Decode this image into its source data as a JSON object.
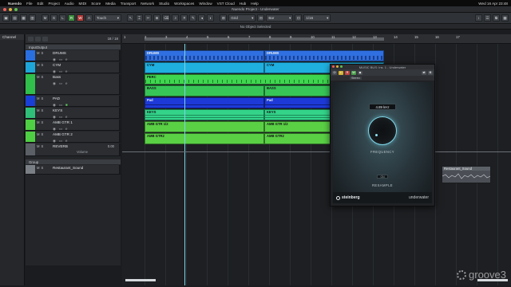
{
  "menubar": {
    "items": [
      "Nuendo",
      "File",
      "Edit",
      "Project",
      "Audio",
      "MIDI",
      "Score",
      "Media",
      "Transport",
      "Network",
      "Studio",
      "Workspaces",
      "Window",
      "VST Cloud",
      "Hub",
      "Help"
    ],
    "clock": "Wed 16 Apr 23:48"
  },
  "window": {
    "title": "Nuendo Project - Underwater"
  },
  "toolbar": {
    "buttons": [
      "M",
      "S",
      "L",
      "R",
      "W",
      "A"
    ],
    "automation_mode": "Touch",
    "snap_mode": "Grid",
    "grid_type": "Bar",
    "quantize": "1/16"
  },
  "status": {
    "text": "No Object Selected"
  },
  "left_zone": {
    "header": "Channel"
  },
  "tracklist": {
    "count": "18 / 18",
    "folders": [
      {
        "label": "InputOutput"
      },
      {
        "label": "Group"
      }
    ],
    "tracks": [
      {
        "name": "DRUMS",
        "color": "#2a6fe0"
      },
      {
        "name": "CYM",
        "color": "#1fa6d8"
      },
      {
        "name": "Bass",
        "color": "#2fbf4a"
      },
      {
        "name": "PERC",
        "color": "#2fbf4a"
      },
      {
        "name": "PAD",
        "color": "#1a3fd6"
      },
      {
        "name": "KEYS",
        "color": "#2fbf78"
      },
      {
        "name": "AMB GTR 1",
        "color": "#4fcf43"
      },
      {
        "name": "AMB GTR 2",
        "color": "#4fcf43"
      },
      {
        "name": "REVERB",
        "color": "#5b6066",
        "value": "0.00",
        "send": "Volume"
      },
      {
        "name": "Restaurant_Sound",
        "color": "#7a7f86"
      }
    ]
  },
  "ruler": {
    "numbers": [
      "1",
      "2",
      "3",
      "4",
      "5",
      "6",
      "7",
      "8",
      "9",
      "10",
      "11",
      "12",
      "13",
      "14",
      "15",
      "16",
      "17"
    ]
  },
  "arrange": {
    "events": [
      {
        "label": "DRUMS",
        "color": "#2f6fe0"
      },
      {
        "label": "DRUMS",
        "color": "#2f6fe0"
      },
      {
        "label": "CYM",
        "color": "#1fb0e0"
      },
      {
        "label": "CYM",
        "color": "#1fb0e0"
      },
      {
        "label": "PERC",
        "color": "#3fd64f"
      },
      {
        "label": "BASS",
        "color": "#37c557"
      },
      {
        "label": "BASS",
        "color": "#37c557"
      },
      {
        "label": "Pad",
        "color": "#1d3ad8"
      },
      {
        "label": "Pad",
        "color": "#1d3ad8"
      },
      {
        "label": "KEYS",
        "color": "#33d38a"
      },
      {
        "label": "KEYS",
        "color": "#33d38a"
      },
      {
        "label": "AMB GTR 1/2",
        "color": "#5ad045"
      },
      {
        "label": "AMB GTR 1/2",
        "color": "#5ad045"
      },
      {
        "label": "AMB GTR2",
        "color": "#5ad045"
      },
      {
        "label": "AMB GTR2",
        "color": "#5ad045"
      }
    ],
    "audio_clip": "Restaurant_Sound"
  },
  "plugin": {
    "title": "MUSIC BUS: Ins. 1 - Underwater",
    "preset_bar": [
      "Stereo"
    ],
    "frequency_value": "4.89 kHz",
    "frequency_label": "FREQUENCY",
    "resample_mini": "ON",
    "resample_label": "RESAMPLE",
    "brand": "steinberg",
    "product": "underwater"
  },
  "watermark": {
    "text": "groove3"
  }
}
